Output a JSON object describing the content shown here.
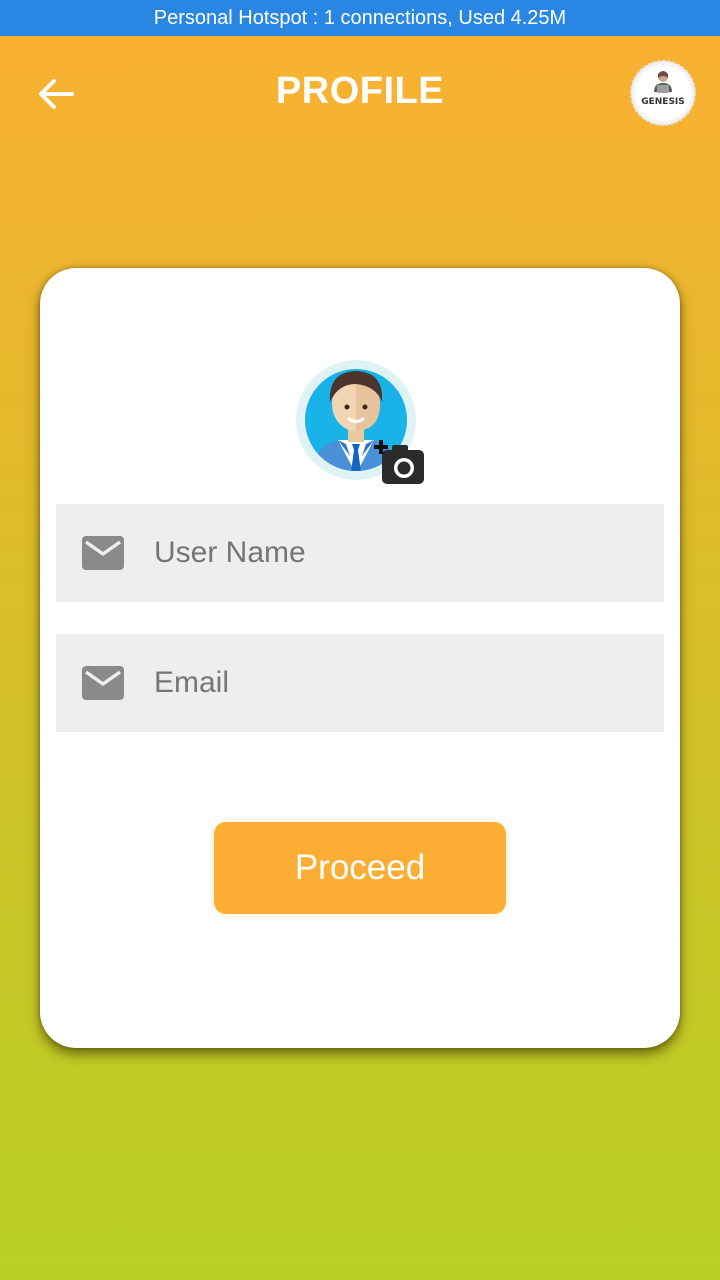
{
  "status_bar": {
    "text": "Personal Hotspot : 1 connections, Used 4.25M"
  },
  "header": {
    "title": "PROFILE",
    "back_icon": "arrow-left-icon",
    "brand_logo_text": "GENESIS"
  },
  "profile_form": {
    "avatar_icon": "businessman-avatar",
    "camera_icon": "add-photo-camera-icon",
    "username": {
      "placeholder": "User Name",
      "value": "",
      "icon": "mail-icon"
    },
    "email": {
      "placeholder": "Email",
      "value": "",
      "icon": "mail-icon"
    },
    "proceed_label": "Proceed"
  },
  "colors": {
    "status_bar": "#2a86e3",
    "gradient_top": "#fcb033",
    "gradient_bottom": "#b8d024",
    "button": "#fbae33",
    "field_bg": "#eeeeee",
    "icon_gray": "#8a8a8a"
  }
}
